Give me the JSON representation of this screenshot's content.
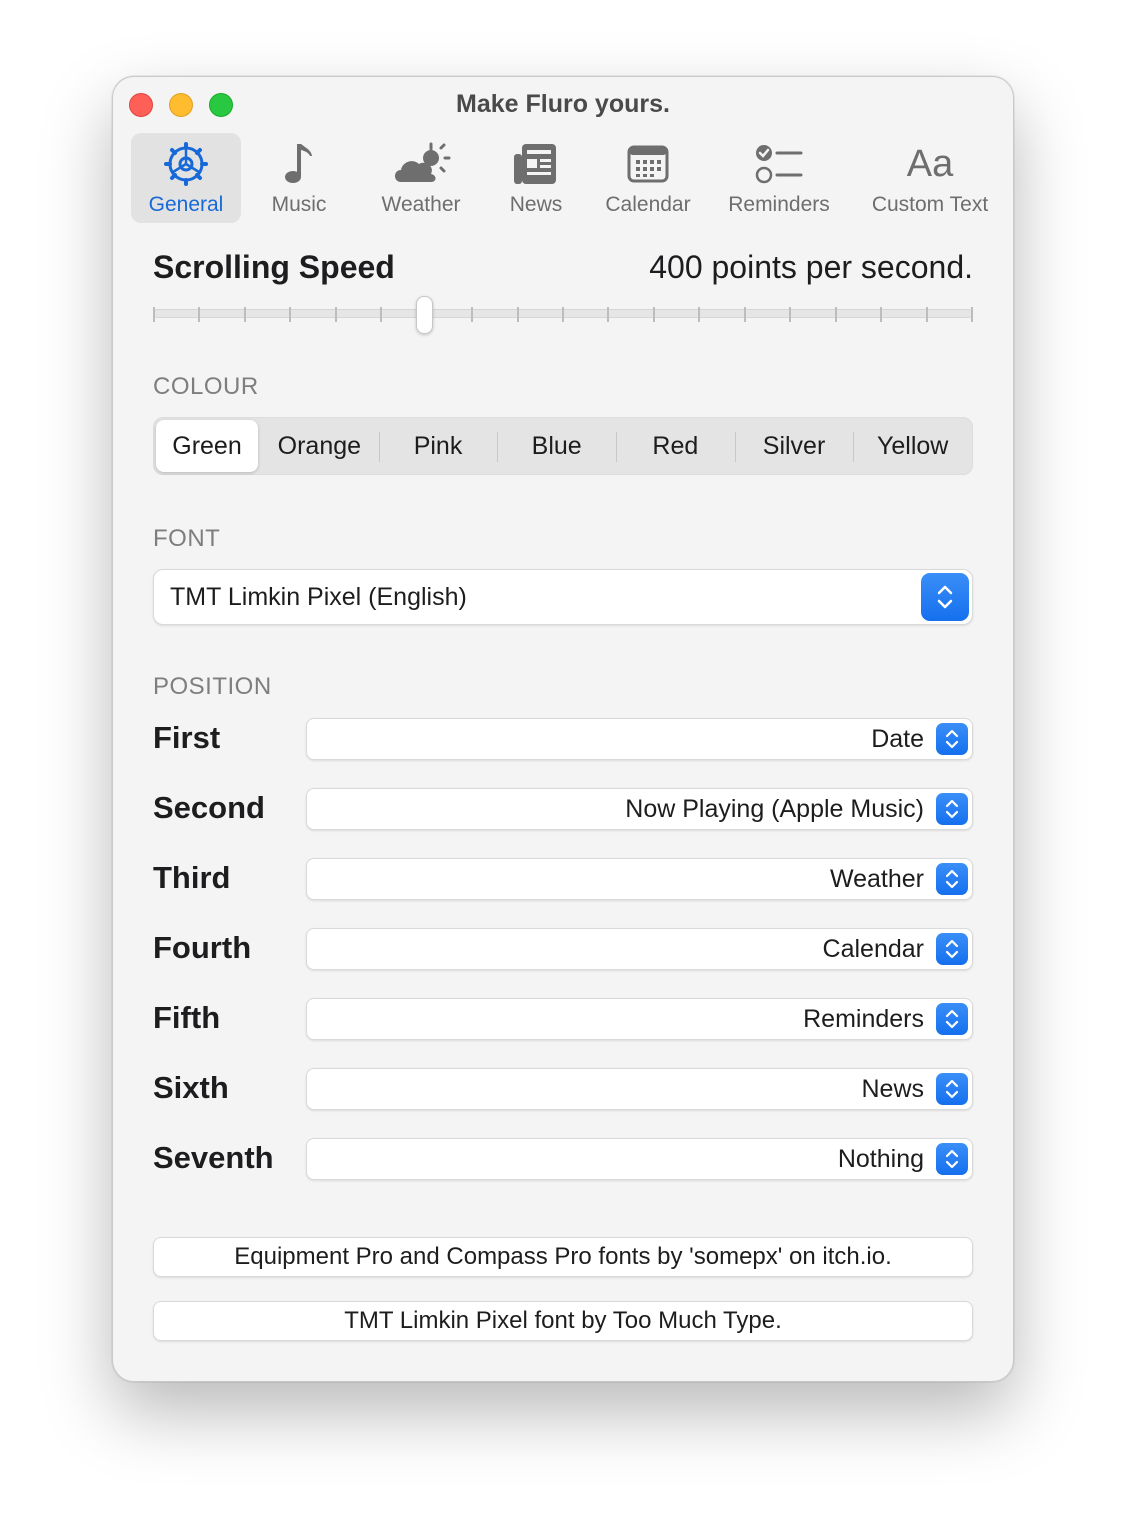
{
  "window": {
    "title": "Make Fluro yours."
  },
  "toolbar": {
    "items": [
      {
        "label": "General",
        "icon": "gear-icon",
        "active": true
      },
      {
        "label": "Music",
        "icon": "music-note-icon"
      },
      {
        "label": "Weather",
        "icon": "cloud-sun-icon"
      },
      {
        "label": "News",
        "icon": "newspaper-icon"
      },
      {
        "label": "Calendar",
        "icon": "calendar-icon"
      },
      {
        "label": "Reminders",
        "icon": "checklist-icon"
      },
      {
        "label": "Custom Text",
        "icon": "text-aa-icon",
        "glyph": "Aa"
      }
    ]
  },
  "speed": {
    "title": "Scrolling Speed",
    "value_text": "400 points per second.",
    "slider_fraction": 0.33
  },
  "colour": {
    "label": "COLOUR",
    "options": [
      "Green",
      "Orange",
      "Pink",
      "Blue",
      "Red",
      "Silver",
      "Yellow"
    ],
    "selected": "Green"
  },
  "font": {
    "label": "FONT",
    "selected": "TMT Limkin Pixel (English)"
  },
  "position": {
    "label": "POSITION",
    "rows": [
      {
        "label": "First",
        "value": "Date"
      },
      {
        "label": "Second",
        "value": "Now Playing (Apple Music)"
      },
      {
        "label": "Third",
        "value": "Weather"
      },
      {
        "label": "Fourth",
        "value": "Calendar"
      },
      {
        "label": "Fifth",
        "value": "Reminders"
      },
      {
        "label": "Sixth",
        "value": "News"
      },
      {
        "label": "Seventh",
        "value": "Nothing"
      }
    ]
  },
  "credits": [
    "Equipment Pro and Compass Pro fonts by 'somepx' on itch.io.",
    "TMT Limkin Pixel font by Too Much Type."
  ],
  "colors": {
    "accent": "#1769d8",
    "stepper": "#1570ee"
  }
}
